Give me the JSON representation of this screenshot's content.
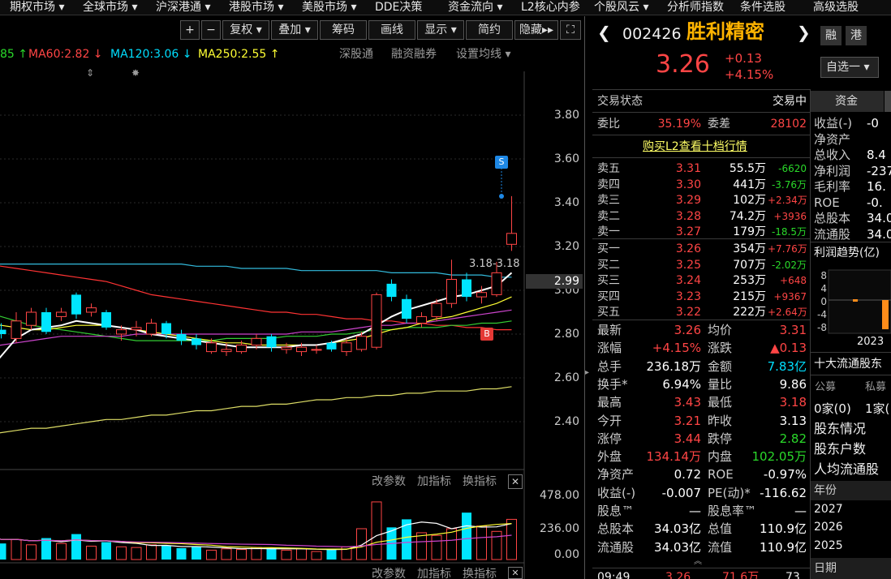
{
  "menu": [
    "期权市场 ▾",
    "全球市场 ▾",
    "沪深港通 ▾",
    "港股市场 ▾",
    "美股市场 ▾",
    "DDE决策",
    "资金流向 ▾",
    "L2核心内参",
    "个股风云 ▾",
    "分析师指数",
    "条件选股",
    "高级选股"
  ],
  "toolbar": {
    "plus": "+",
    "minus": "−",
    "fuquan": "复权",
    "diejia": "叠加",
    "chouma": "筹码",
    "huaxian": "画线",
    "xianshi": "显示",
    "jianyue": "简约",
    "yincang": "隐藏"
  },
  "ma": {
    "ma_partial": "85 ↑",
    "ma60": "MA60:2.82 ↓",
    "ma120": "MA120:3.06 ↓",
    "ma250": "MA250:2.55 ↑",
    "shentong": "深股通",
    "rongzi": "融资融券",
    "shezhi": "设置均线"
  },
  "price_axis": [
    "3.80",
    "3.60",
    "3.40",
    "3.20",
    "3.00",
    "2.80",
    "2.60",
    "2.40"
  ],
  "current_price_tag": "2.99",
  "price_annotation": "3.18-3.18",
  "markers": {
    "sell": "S",
    "buy": "B"
  },
  "vol": {
    "gaicanshu": "改参数",
    "jiazhibiao": "加指标",
    "huanzhibiao": "换指标",
    "axis": [
      "478.00",
      "236.00",
      "0.00"
    ]
  },
  "colors": {
    "up": "#ff4545",
    "down": "#00e5ff",
    "ma5": "#ffffff",
    "ma10": "#ffff33",
    "ma20": "#cc44cc",
    "ma30": "#33cc33",
    "ma60": "#ff3333",
    "ma120": "#33bbdd",
    "ma250": "#dddd66"
  },
  "chart_data": {
    "type": "candlestick",
    "ylim": [
      2.3,
      3.85
    ],
    "candles": [
      {
        "o": 2.75,
        "c": 2.85,
        "h": 2.88,
        "l": 2.72
      },
      {
        "o": 2.82,
        "c": 2.8,
        "h": 2.85,
        "l": 2.78
      },
      {
        "o": 2.78,
        "c": 2.86,
        "h": 2.9,
        "l": 2.76
      },
      {
        "o": 2.84,
        "c": 2.9,
        "h": 2.92,
        "l": 2.82
      },
      {
        "o": 2.9,
        "c": 2.81,
        "h": 2.92,
        "l": 2.8
      },
      {
        "o": 2.88,
        "c": 2.9,
        "h": 2.92,
        "l": 2.86
      },
      {
        "o": 2.98,
        "c": 2.89,
        "h": 2.99,
        "l": 2.87
      },
      {
        "o": 2.9,
        "c": 2.92,
        "h": 2.94,
        "l": 2.88
      },
      {
        "o": 2.9,
        "c": 2.83,
        "h": 2.91,
        "l": 2.82
      },
      {
        "o": 2.8,
        "c": 2.82,
        "h": 2.84,
        "l": 2.77
      },
      {
        "o": 2.82,
        "c": 2.83,
        "h": 2.86,
        "l": 2.79
      },
      {
        "o": 2.8,
        "c": 2.85,
        "h": 2.87,
        "l": 2.79
      },
      {
        "o": 2.85,
        "c": 2.8,
        "h": 2.86,
        "l": 2.78
      },
      {
        "o": 2.8,
        "c": 2.77,
        "h": 2.82,
        "l": 2.75
      },
      {
        "o": 2.78,
        "c": 2.75,
        "h": 2.8,
        "l": 2.73
      },
      {
        "o": 2.72,
        "c": 2.76,
        "h": 2.78,
        "l": 2.71
      },
      {
        "o": 2.72,
        "c": 2.73,
        "h": 2.76,
        "l": 2.7
      },
      {
        "o": 2.72,
        "c": 2.75,
        "h": 2.77,
        "l": 2.71
      },
      {
        "o": 2.75,
        "c": 2.78,
        "h": 2.8,
        "l": 2.73
      },
      {
        "o": 2.79,
        "c": 2.74,
        "h": 2.8,
        "l": 2.72
      },
      {
        "o": 2.73,
        "c": 2.74,
        "h": 2.76,
        "l": 2.71
      },
      {
        "o": 2.72,
        "c": 2.74,
        "h": 2.76,
        "l": 2.7
      },
      {
        "o": 2.73,
        "c": 2.73,
        "h": 2.75,
        "l": 2.71
      },
      {
        "o": 2.76,
        "c": 2.73,
        "h": 2.77,
        "l": 2.72
      },
      {
        "o": 2.72,
        "c": 2.76,
        "h": 2.78,
        "l": 2.7
      },
      {
        "o": 2.73,
        "c": 2.79,
        "h": 2.81,
        "l": 2.72
      },
      {
        "o": 2.74,
        "c": 2.98,
        "h": 2.99,
        "l": 2.73
      },
      {
        "o": 3.03,
        "c": 2.97,
        "h": 3.05,
        "l": 2.95
      },
      {
        "o": 2.96,
        "c": 2.87,
        "h": 2.98,
        "l": 2.85
      },
      {
        "o": 2.85,
        "c": 2.88,
        "h": 2.9,
        "l": 2.83
      },
      {
        "o": 2.88,
        "c": 2.94,
        "h": 2.96,
        "l": 2.86
      },
      {
        "o": 2.94,
        "c": 3.05,
        "h": 3.14,
        "l": 2.92
      },
      {
        "o": 3.05,
        "c": 2.97,
        "h": 3.08,
        "l": 2.95
      },
      {
        "o": 2.97,
        "c": 2.99,
        "h": 3.02,
        "l": 2.94
      },
      {
        "o": 2.98,
        "c": 3.08,
        "h": 3.13,
        "l": 2.97
      },
      {
        "o": 3.21,
        "c": 3.26,
        "h": 3.43,
        "l": 3.18
      }
    ],
    "volumes": [
      180,
      120,
      150,
      110,
      160,
      120,
      190,
      100,
      130,
      95,
      90,
      110,
      105,
      85,
      95,
      70,
      80,
      75,
      90,
      85,
      70,
      80,
      60,
      75,
      95,
      230,
      430,
      240,
      300,
      200,
      180,
      230,
      350,
      250,
      210,
      300,
      230
    ],
    "ma5": [
      2.62,
      2.7,
      2.78,
      2.82,
      2.83,
      2.84,
      2.86,
      2.85,
      2.84,
      2.83,
      2.82,
      2.8,
      2.79,
      2.78,
      2.77,
      2.76,
      2.75,
      2.74,
      2.74,
      2.74,
      2.74,
      2.75,
      2.75,
      2.76,
      2.78,
      2.8,
      2.84,
      2.88,
      2.91,
      2.93,
      2.95,
      2.97,
      2.98,
      3.0,
      3.02,
      3.08
    ],
    "ma10": [
      2.85,
      2.84,
      2.83,
      2.82,
      2.82,
      2.83,
      2.84,
      2.84,
      2.84,
      2.83,
      2.82,
      2.81,
      2.8,
      2.79,
      2.78,
      2.77,
      2.76,
      2.76,
      2.75,
      2.75,
      2.75,
      2.75,
      2.75,
      2.76,
      2.77,
      2.78,
      2.8,
      2.82,
      2.83,
      2.85,
      2.87,
      2.88,
      2.9,
      2.92,
      2.94,
      2.97
    ],
    "ma20": [
      2.74,
      2.75,
      2.76,
      2.77,
      2.78,
      2.79,
      2.79,
      2.79,
      2.79,
      2.79,
      2.8,
      2.8,
      2.8,
      2.8,
      2.8,
      2.8,
      2.8,
      2.8,
      2.8,
      2.8,
      2.8,
      2.81,
      2.81,
      2.81,
      2.82,
      2.83,
      2.84,
      2.84,
      2.85,
      2.85,
      2.86,
      2.87,
      2.88,
      2.89,
      2.9,
      2.91
    ],
    "ma30": [
      2.9,
      2.88,
      2.86,
      2.84,
      2.83,
      2.82,
      2.81,
      2.8,
      2.79,
      2.78,
      2.77,
      2.77,
      2.77,
      2.77,
      2.77,
      2.77,
      2.78,
      2.78,
      2.78,
      2.78,
      2.79,
      2.79,
      2.79,
      2.8,
      2.8,
      2.81,
      2.82,
      2.82,
      2.83,
      2.83,
      2.83,
      2.84,
      2.84,
      2.85,
      2.85,
      2.86
    ],
    "ma60": [
      3.12,
      3.11,
      3.1,
      3.09,
      3.08,
      3.07,
      3.06,
      3.05,
      3.04,
      3.02,
      3.0,
      2.98,
      2.97,
      2.96,
      2.95,
      2.94,
      2.93,
      2.92,
      2.91,
      2.9,
      2.9,
      2.89,
      2.89,
      2.88,
      2.87,
      2.87,
      2.86,
      2.86,
      2.85,
      2.85,
      2.84,
      2.84,
      2.83,
      2.83,
      2.82,
      2.82
    ],
    "ma120": [
      3.12,
      3.12,
      3.12,
      3.12,
      3.12,
      3.12,
      3.12,
      3.12,
      3.12,
      3.12,
      3.12,
      3.12,
      3.12,
      3.12,
      3.11,
      3.11,
      3.11,
      3.1,
      3.1,
      3.1,
      3.1,
      3.09,
      3.09,
      3.09,
      3.09,
      3.09,
      3.09,
      3.08,
      3.08,
      3.08,
      3.08,
      3.07,
      3.07,
      3.07,
      3.06,
      3.06
    ],
    "ma250": [
      2.34,
      2.35,
      2.36,
      2.37,
      2.37,
      2.38,
      2.39,
      2.4,
      2.41,
      2.41,
      2.42,
      2.43,
      2.43,
      2.44,
      2.45,
      2.45,
      2.46,
      2.47,
      2.47,
      2.48,
      2.48,
      2.49,
      2.5,
      2.5,
      2.51,
      2.51,
      2.52,
      2.52,
      2.53,
      2.53,
      2.54,
      2.54,
      2.54,
      2.55,
      2.55,
      2.56
    ]
  },
  "stock": {
    "code": "002426",
    "name": "胜利精密",
    "price": "3.26",
    "change": "+0.13",
    "pct": "+4.15%",
    "rong": "融",
    "gang": "港",
    "zixuan": "自选一"
  },
  "panel": {
    "jiaoyi_label": "交易状态",
    "jiaoyi_val": "交易中",
    "weibi_label": "委比",
    "weibi_val": "35.19%",
    "weicha_label": "委差",
    "weicha_val": "28102",
    "buy_l2": "购买L2查看十档行情",
    "sells": [
      [
        "卖五",
        "3.31",
        "55.5万",
        "-6620"
      ],
      [
        "卖四",
        "3.30",
        "441万",
        "-3.76万"
      ],
      [
        "卖三",
        "3.29",
        "102万",
        "+2.34万"
      ],
      [
        "卖二",
        "3.28",
        "74.2万",
        "+3936"
      ],
      [
        "卖一",
        "3.27",
        "179万",
        "-18.5万"
      ]
    ],
    "buys": [
      [
        "买一",
        "3.26",
        "354万",
        "+7.76万"
      ],
      [
        "买二",
        "3.25",
        "707万",
        "-2.02万"
      ],
      [
        "买三",
        "3.24",
        "253万",
        "+648"
      ],
      [
        "买四",
        "3.23",
        "215万",
        "+9367"
      ],
      [
        "买五",
        "3.22",
        "222万",
        "+2.64万"
      ]
    ],
    "stats": [
      [
        "最新",
        "3.26",
        "均价",
        "3.31"
      ],
      [
        "涨幅",
        "+4.15%",
        "涨跌",
        "▲0.13"
      ],
      [
        "总手",
        "236.18万",
        "金额",
        "7.83亿"
      ],
      [
        "换手*",
        "6.94%",
        "量比",
        "9.86"
      ],
      [
        "最高",
        "3.43",
        "最低",
        "3.18"
      ],
      [
        "今开",
        "3.21",
        "昨收",
        "3.13"
      ],
      [
        "涨停",
        "3.44",
        "跌停",
        "2.82"
      ],
      [
        "外盘",
        "134.14万",
        "内盘",
        "102.05万"
      ],
      [
        "净资产",
        "0.72",
        "ROE",
        "-0.97%"
      ],
      [
        "收益(-)",
        "-0.007",
        "PE(动)*",
        "-116.62"
      ],
      [
        "股息™",
        "—",
        "股息率™",
        "—"
      ],
      [
        "总股本",
        "34.03亿",
        "总值",
        "110.9亿"
      ],
      [
        "流通股",
        "34.03亿",
        "流值",
        "110.9亿"
      ]
    ],
    "tick": [
      "09:49",
      "3.26",
      "71.6万",
      "73"
    ]
  },
  "side": {
    "zijin": "资金",
    "fin": [
      [
        "收益(-)",
        "-0"
      ],
      [
        "净资产",
        ""
      ],
      [
        "总收入",
        "8.4"
      ],
      [
        "净利润",
        "-237"
      ],
      [
        "毛利率",
        "16."
      ],
      [
        "ROE",
        "-0."
      ],
      [
        "总股本",
        "34.0"
      ],
      [
        "流通股",
        "34.0"
      ]
    ],
    "lirun": "利润趋势(亿)",
    "lirun_axis": [
      "8",
      "4",
      "0",
      "-4",
      "-8"
    ],
    "lirun_year": "2023",
    "shida": "十大流通股东",
    "gongmu": "公募",
    "simu": "私募",
    "jia0": "0家(0)",
    "jia1": "1家(",
    "links": [
      "股东情况",
      "股东户数",
      "人均流通股"
    ],
    "nianfen": "年份",
    "years": [
      "2027",
      "2026",
      "2025"
    ],
    "riqi": "日期"
  }
}
